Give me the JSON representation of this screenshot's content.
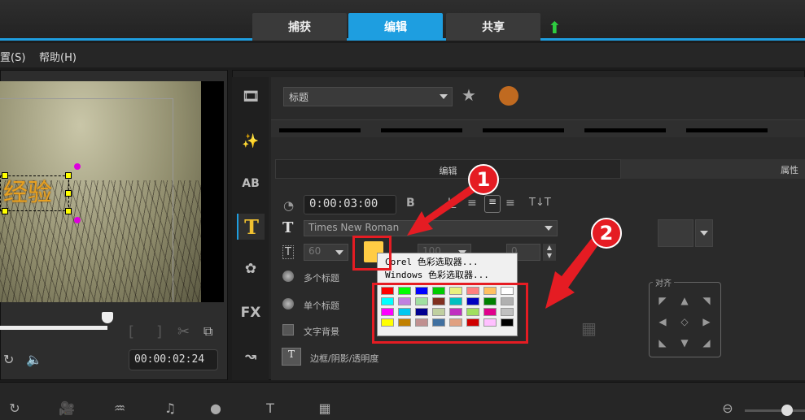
{
  "tabs": [
    {
      "label": "捕获"
    },
    {
      "label": "编辑"
    },
    {
      "label": "共享"
    }
  ],
  "menu": [
    {
      "label": "置(S)"
    },
    {
      "label": "帮助(H)"
    }
  ],
  "preview": {
    "overlay_text": "经验",
    "timecode": "00:00:02:24",
    "progress": 0.48
  },
  "title_panel": {
    "category": "标题",
    "subtabs": {
      "edit": "编辑",
      "attributes": "属性"
    },
    "duration": "0:00:03:00",
    "font": "Times New Roman",
    "font_size": "60",
    "line_spacing": "100",
    "angle": "0",
    "options": {
      "multi_title": "多个标题",
      "single_title": "单个标题",
      "text_background": "文字背景",
      "border_shadow": "边框/阴影/透明度"
    },
    "align_label": "对齐",
    "text_color": "#ffcc44"
  },
  "color_popup": {
    "corel": "Corel 色彩选取器...",
    "windows": "Windows 色彩选取器...",
    "swatches": [
      "#ff0000",
      "#00ff00",
      "#0000ff",
      "#00cc00",
      "#e8f080",
      "#ff8080",
      "#ffc060",
      "#ffffff",
      "#00ffff",
      "#c080e0",
      "#a0e0a0",
      "#803020",
      "#00c0c0",
      "#0000c0",
      "#008000",
      "#b0b0b0",
      "#ff00ff",
      "#00c8f0",
      "#000090",
      "#c0d0a0",
      "#c030c0",
      "#a0e060",
      "#e0008c",
      "#c0c0c0",
      "#ffff00",
      "#c08000",
      "#c09090",
      "#4070a0",
      "#e0a080",
      "#d00000",
      "#ffc0ff",
      "#000000"
    ]
  },
  "annotations": {
    "step1": "1",
    "step2": "2"
  },
  "format_buttons": {
    "bold": "B",
    "italic": "I",
    "underline": "U"
  },
  "sidebar_fx": "FX"
}
